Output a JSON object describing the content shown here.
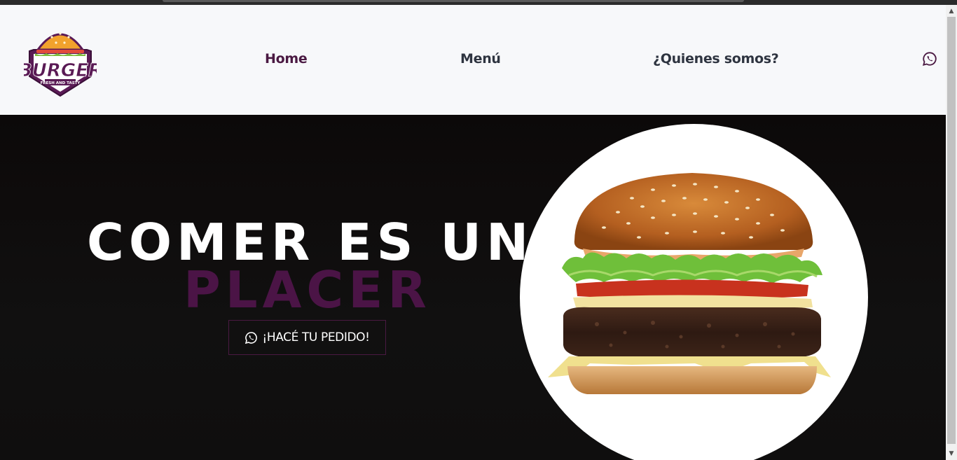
{
  "navbar": {
    "logo": {
      "text": "BURGER",
      "tagline": "FRESH AND TASTY",
      "icon": "burger-logo-icon"
    },
    "links": [
      {
        "label": "Home",
        "active": true
      },
      {
        "label": "Menú",
        "active": false
      },
      {
        "label": "¿Quienes somos?",
        "active": false
      }
    ],
    "whatsapp_icon": "whatsapp-icon"
  },
  "hero": {
    "title_line_1": "COMER ES UN",
    "title_line_2": "PLACER",
    "order_button": {
      "label": "¡HACÉ TU PEDIDO!",
      "icon": "whatsapp-icon"
    },
    "image": "hamburger-photo"
  },
  "colors": {
    "brand_purple": "#4b1446",
    "nav_text": "#2e3440",
    "hero_bg": "#0c0909",
    "header_bg": "#f7f8fa",
    "logo_orange": "#f2a22c"
  }
}
